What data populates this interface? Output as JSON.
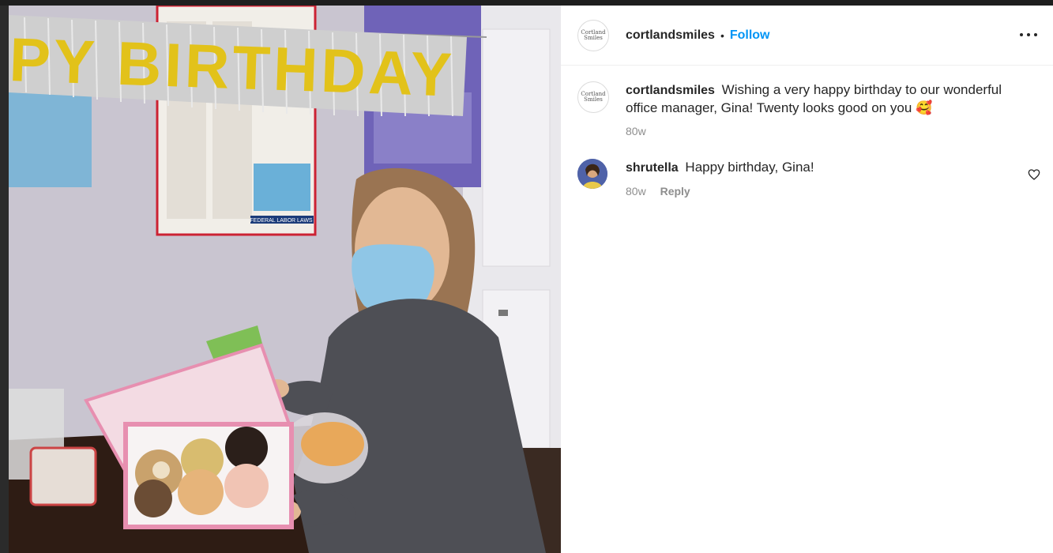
{
  "post": {
    "author": "cortlandsmiles",
    "separator": "•",
    "follow_label": "Follow",
    "avatar_logo_text": "Cortland Smiles",
    "more_icon": "more-horizontal-icon"
  },
  "photo": {
    "banner_text": "PY BIRTHDAY",
    "poster_text": "FEDERAL LABOR LAWS"
  },
  "caption": {
    "username": "cortlandsmiles",
    "text": "Wishing a very happy birthday to our wonderful office manager, Gina! Twenty looks good on you 🥰",
    "time": "80w"
  },
  "comments": [
    {
      "username": "shrutella",
      "text": "Happy birthday, Gina!",
      "time": "80w",
      "reply_label": "Reply",
      "like_icon": "heart-outline-icon"
    }
  ],
  "colors": {
    "accent": "#0095f6",
    "text": "#262626",
    "muted": "#8e8e8e"
  }
}
